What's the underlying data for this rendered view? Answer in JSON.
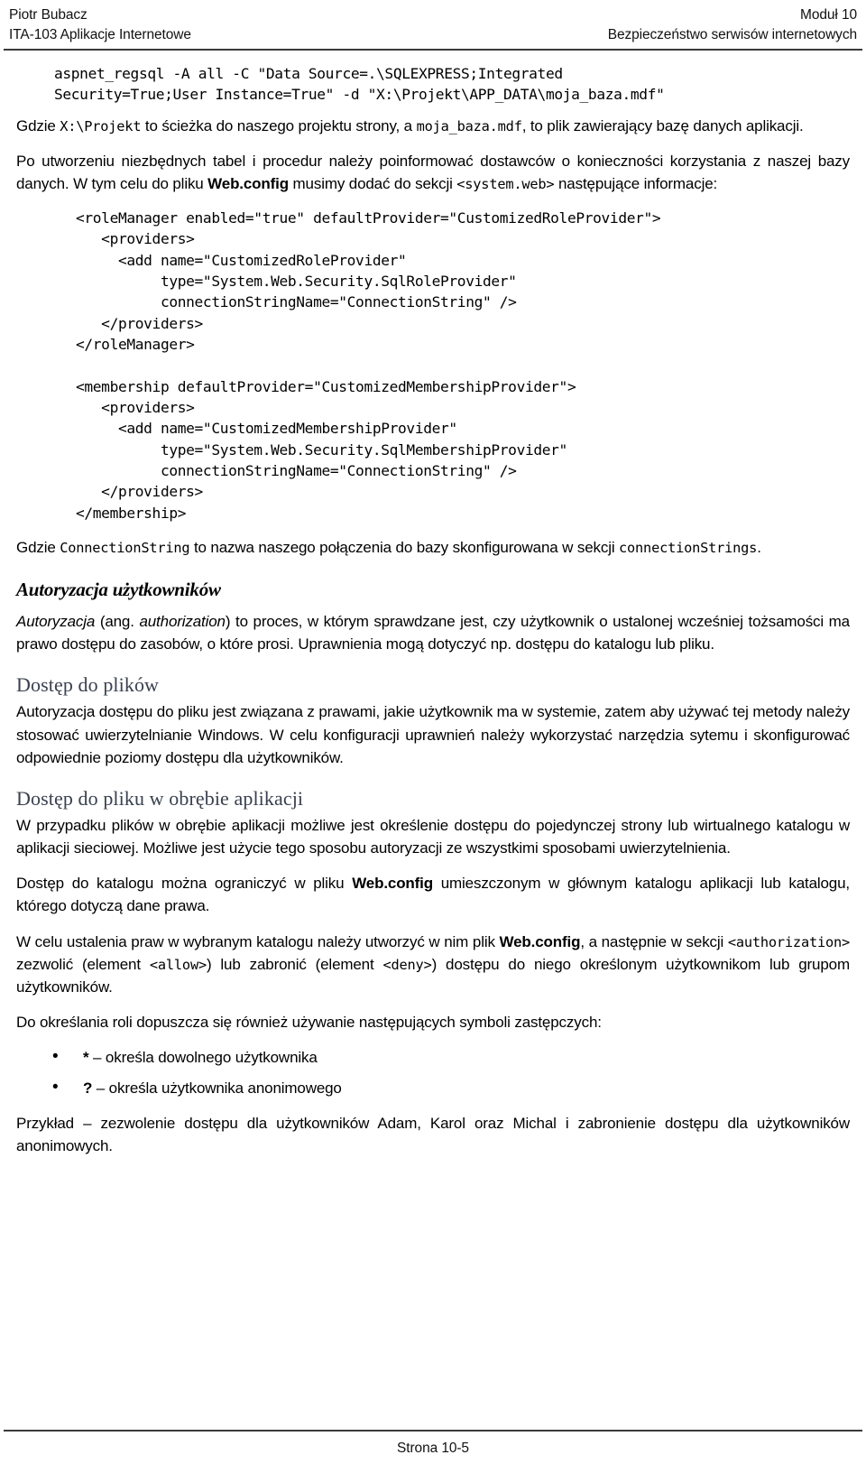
{
  "header": {
    "author": "Piotr Bubacz",
    "module": "Moduł 10",
    "course": "ITA-103 Aplikacje Internetowe",
    "subject": "Bezpieczeństwo serwisów internetowych"
  },
  "content": {
    "command_block": "aspnet_regsql -A all -C \"Data Source=.\\SQLEXPRESS;Integrated\nSecurity=True;User Instance=True\" -d \"X:\\Projekt\\APP_DATA\\moja_baza.mdf\"",
    "para_gdzie_x": {
      "t1": "Gdzie ",
      "m1": "X:\\Projekt",
      "t2": " to ścieżka do naszego projektu strony, a ",
      "m2": "moja_baza.mdf",
      "t3": ", to plik zawierający bazę danych aplikacji."
    },
    "para_po_utworzeniu": {
      "t1": "Po utworzeniu niezbędnych tabel i procedur należy poinformować dostawców o konieczności korzystania z naszej bazy danych. W tym celu do pliku ",
      "b1": "Web.config",
      "t2": " musimy dodać do sekcji ",
      "m1": "<system.web>",
      "t3": " następujące informacje:"
    },
    "config_block": "<roleManager enabled=\"true\" defaultProvider=\"CustomizedRoleProvider\">\n   <providers>\n     <add name=\"CustomizedRoleProvider\"\n          type=\"System.Web.Security.SqlRoleProvider\"\n          connectionStringName=\"ConnectionString\" />\n   </providers>\n</roleManager>\n\n<membership defaultProvider=\"CustomizedMembershipProvider\">\n   <providers>\n     <add name=\"CustomizedMembershipProvider\"\n          type=\"System.Web.Security.SqlMembershipProvider\"\n          connectionStringName=\"ConnectionString\" />\n   </providers>\n</membership>",
    "para_gdzie_cs": {
      "t1": "Gdzie ",
      "m1": "ConnectionString",
      "t2": " to nazwa naszego połączenia do bazy skonfigurowana w sekcji ",
      "m2": "connectionStrings",
      "t3": "."
    },
    "heading_autoryzacja": "Autoryzacja użytkowników",
    "para_autoryzacja_def": {
      "i1": "Autoryzacja",
      "t1": " (ang. ",
      "i2": "authorization",
      "t2": ") to proces, w którym sprawdzane jest, czy użytkownik o ustalonej wcześniej tożsamości ma prawo dostępu do zasobów, o które prosi. Uprawnienia mogą dotyczyć np. dostępu do katalogu lub pliku."
    },
    "heading_dostep_pliki": "Dostęp do plików",
    "para_dostep_pliki": "Autoryzacja dostępu do pliku jest związana z prawami, jakie użytkownik ma w systemie, zatem aby używać tej metody należy stosować uwierzytelnianie Windows. W celu konfiguracji uprawnień należy wykorzystać narzędzia sytemu i skonfigurować odpowiednie poziomy dostępu dla użytkowników.",
    "heading_dostep_aplikacja": "Dostęp do pliku w obrębie aplikacji",
    "para_dostep_aplikacja": "W przypadku plików w obrębie aplikacji możliwe jest określenie dostępu do pojedynczej strony lub wirtualnego katalogu w aplikacji sieciowej. Możliwe jest użycie tego sposobu autoryzacji ze wszystkimi sposobami uwierzytelnienia.",
    "para_dostep_katalog": {
      "t1": "Dostęp do katalogu można ograniczyć w pliku ",
      "b1": "Web.config",
      "t2": " umieszczonym w głównym katalogu aplikacji lub katalogu, którego dotyczą dane prawa."
    },
    "para_w_celu_ustalenia": {
      "t1": "W celu ustalenia praw w wybranym katalogu należy utworzyć w nim plik ",
      "b1": "Web.config",
      "t2": ", a następnie w sekcji ",
      "m1": "<authorization>",
      "t3": " zezwolić (element ",
      "m2": "<allow>",
      "t4": ") lub zabronić (element ",
      "m3": "<deny>",
      "t5": ") dostępu do niego określonym użytkownikom lub grupom użytkowników."
    },
    "para_do_okreslania": "Do określania roli dopuszcza się również używanie następujących symboli zastępczych:",
    "bullets": [
      {
        "symbol": "*",
        "text": " – określa dowolnego użytkownika"
      },
      {
        "symbol": "?",
        "text": " – określa użytkownika anonimowego"
      }
    ],
    "para_przyklad": "Przykład – zezwolenie dostępu dla użytkowników Adam, Karol oraz Michal i zabronienie dostępu dla użytkowników anonimowych."
  },
  "footer": {
    "page_label": "Strona 10-5"
  },
  "colors": {
    "subheading": "#39404f",
    "rule": "#3a3a3a",
    "text": "#000000"
  }
}
